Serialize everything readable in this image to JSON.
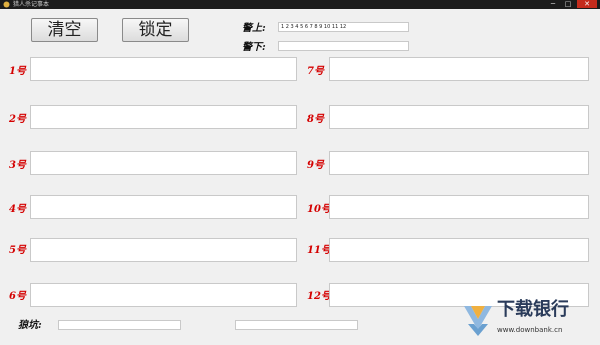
{
  "window": {
    "title": "猎人杀记事本",
    "min": "─",
    "max": "□",
    "close": "✕"
  },
  "buttons": {
    "clear": "清空",
    "lock": "锁定"
  },
  "police": {
    "up_label": "警上:",
    "up_value": "1  2  3  4  5  6  7  8  9  10  11  12",
    "down_label": "警下:",
    "down_value": ""
  },
  "players": [
    {
      "label": "1号",
      "value": ""
    },
    {
      "label": "2号",
      "value": ""
    },
    {
      "label": "3号",
      "value": ""
    },
    {
      "label": "4号",
      "value": ""
    },
    {
      "label": "5号",
      "value": ""
    },
    {
      "label": "6号",
      "value": ""
    },
    {
      "label": "7号",
      "value": ""
    },
    {
      "label": "8号",
      "value": ""
    },
    {
      "label": "9号",
      "value": ""
    },
    {
      "label": "10号",
      "value": ""
    },
    {
      "label": "11号",
      "value": ""
    },
    {
      "label": "12号",
      "value": ""
    }
  ],
  "pit": {
    "label": "狼坑:",
    "value1": "",
    "value2": ""
  },
  "watermark": {
    "brand": "下载银行",
    "url": "www.downbank.cn"
  },
  "colors": {
    "accent_red": "#d40000"
  }
}
